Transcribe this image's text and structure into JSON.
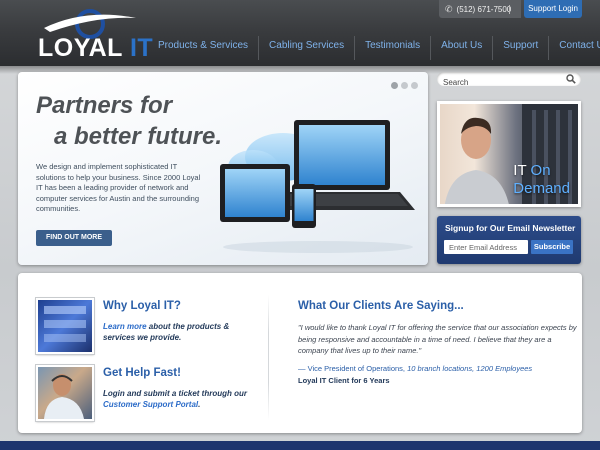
{
  "brand": {
    "name_main": "LOYAL",
    "name_accent": "IT",
    "accent_color": "#2b72c8"
  },
  "topbar": {
    "phone": "(512) 671-7500",
    "phone_icon": "phone-handset-icon",
    "support_login": "Support Login"
  },
  "nav": {
    "items": [
      {
        "label": "Products & Services"
      },
      {
        "label": "Cabling Services"
      },
      {
        "label": "Testimonials"
      },
      {
        "label": "About Us"
      },
      {
        "label": "Support"
      },
      {
        "label": "Contact Us"
      }
    ]
  },
  "hero": {
    "title_line1": "Partners for",
    "title_line2": "a better future.",
    "description": "We design and implement sophisticated IT solutions to help your business. Since 2000 Loyal IT has been a leading provider of network and computer services for Austin and the surrounding communities.",
    "cta": "FIND OUT MORE",
    "slides_total": 3,
    "active_slide": 1
  },
  "search": {
    "placeholder": "Search",
    "icon": "magnifier-icon"
  },
  "promo": {
    "line1_white": "IT",
    "line1_blue": "On",
    "line2": "Demand"
  },
  "newsletter": {
    "title": "Signup for Our Email Newsletter",
    "placeholder": "Enter Email Address",
    "button": "Subscribe"
  },
  "why": {
    "title": "Why Loyal IT?",
    "link_text": "Learn more",
    "text": " about the products & services we provide."
  },
  "help": {
    "title": "Get Help Fast!",
    "text": "Login and submit a ticket through our ",
    "link_text": "Customer Support Portal",
    "text_end": "."
  },
  "clients": {
    "title": "What Our Clients Are Saying...",
    "quote": "\"I would like to thank Loyal IT for offering the service that our association expects by being responsive and accountable in a time of need. I believe that they are a company that lives up to their name.\"",
    "attribution_role": "— Vice President of Operations, ",
    "attribution_detail": "10 branch locations, 1200 Employees",
    "client_label": "Loyal IT Client for 6 Years"
  },
  "colors": {
    "nav_link": "#7fb2ea",
    "heading_blue": "#2b5fa8",
    "button_blue": "#2e6db4",
    "footer": "#1e356e"
  }
}
